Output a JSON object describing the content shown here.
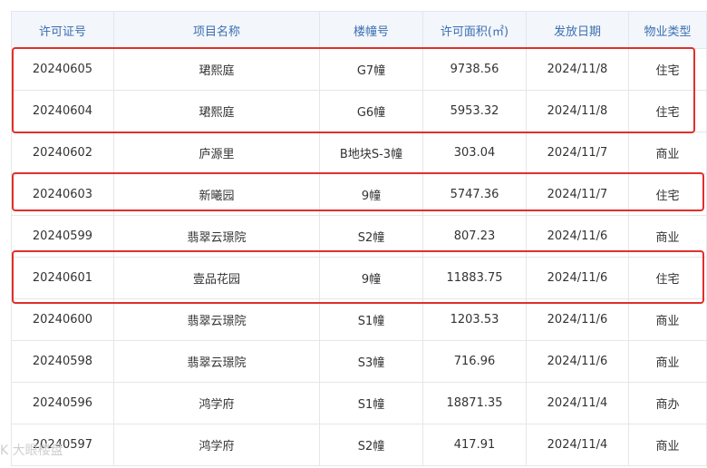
{
  "table": {
    "headers": [
      "许可证号",
      "项目名称",
      "楼幢号",
      "许可面积(㎡)",
      "发放日期",
      "物业类型"
    ],
    "rows": [
      [
        "20240605",
        "珺熙庭",
        "G7幢",
        "9738.56",
        "2024/11/8",
        "住宅"
      ],
      [
        "20240604",
        "珺熙庭",
        "G6幢",
        "5953.32",
        "2024/11/8",
        "住宅"
      ],
      [
        "20240602",
        "庐源里",
        "B地块S-3幢",
        "303.04",
        "2024/11/7",
        "商业"
      ],
      [
        "20240603",
        "新曦园",
        "9幢",
        "5747.36",
        "2024/11/7",
        "住宅"
      ],
      [
        "20240599",
        "翡翠云璟院",
        "S2幢",
        "807.23",
        "2024/11/6",
        "商业"
      ],
      [
        "20240601",
        "壹品花园",
        "9幢",
        "11883.75",
        "2024/11/6",
        "住宅"
      ],
      [
        "20240600",
        "翡翠云璟院",
        "S1幢",
        "1203.53",
        "2024/11/6",
        "商业"
      ],
      [
        "20240598",
        "翡翠云璟院",
        "S3幢",
        "716.96",
        "2024/11/6",
        "商业"
      ],
      [
        "20240596",
        "鸿学府",
        "S1幢",
        "18871.35",
        "2024/11/4",
        "商办"
      ],
      [
        "20240597",
        "鸿学府",
        "S2幢",
        "417.91",
        "2024/11/4",
        "商业"
      ]
    ]
  },
  "watermark": "K 大眼楼盘",
  "colors": {
    "header_text": "#3b6fb3",
    "header_bg": "#f3f6fa",
    "highlight": "#e0302a"
  }
}
